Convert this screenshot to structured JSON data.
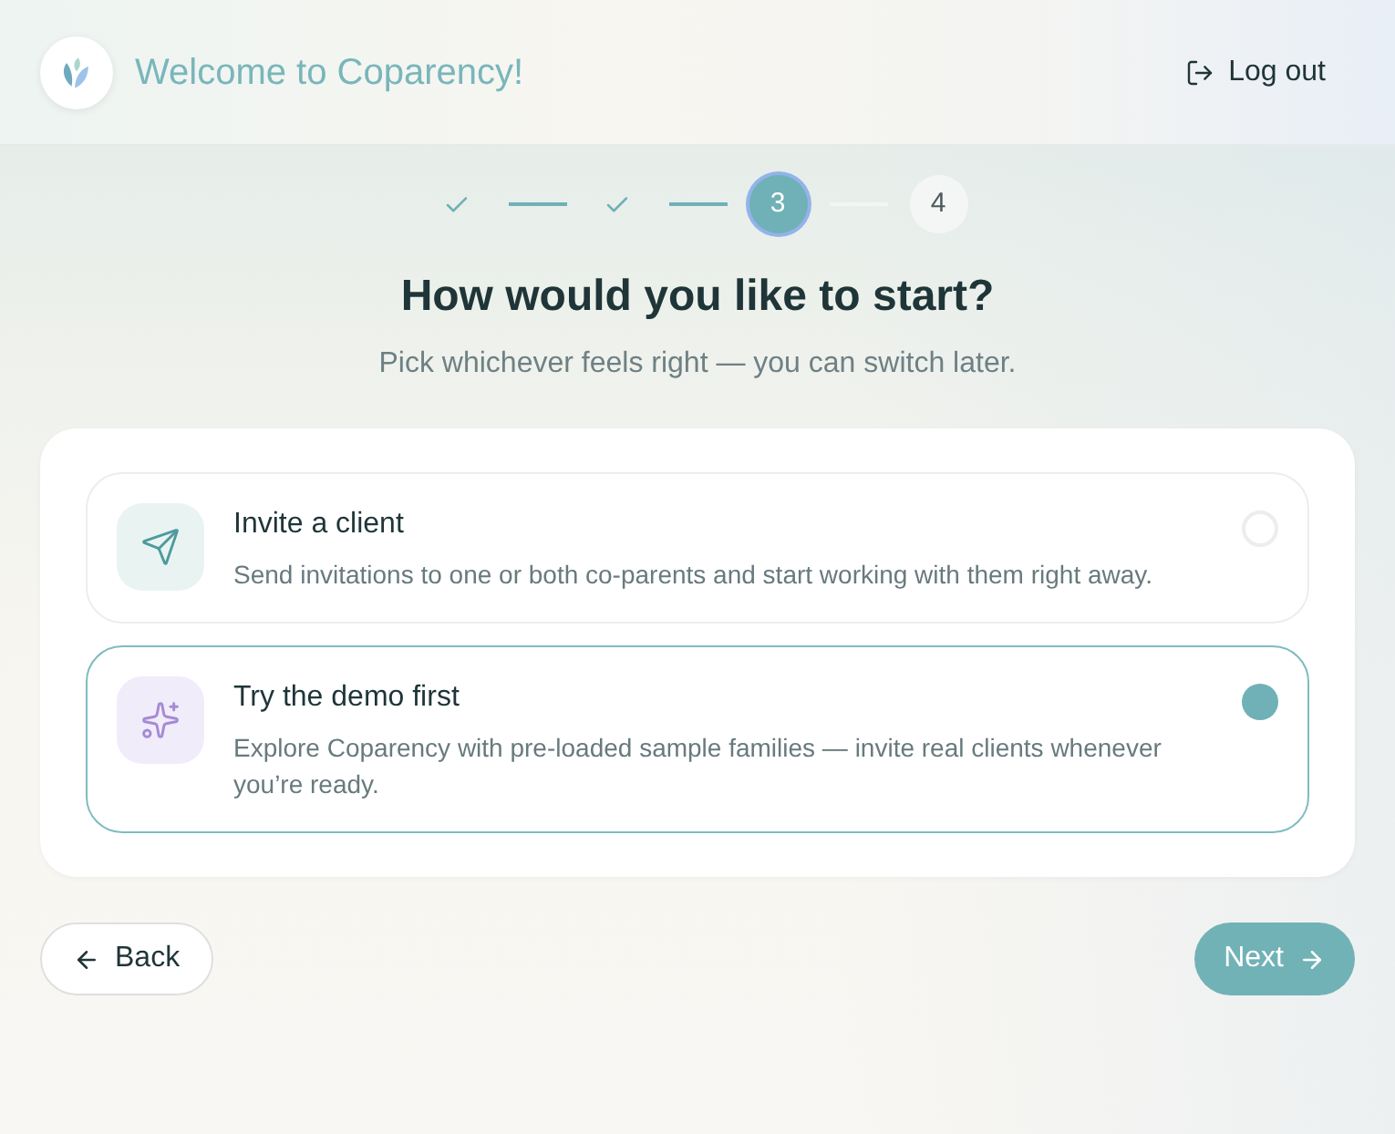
{
  "header": {
    "title": "Welcome to Coparency!",
    "logout": "Log out"
  },
  "stepper": [
    {
      "kind": "done"
    },
    {
      "kind": "done"
    },
    {
      "label": "3",
      "kind": "current"
    },
    {
      "label": "4",
      "kind": "upcoming"
    }
  ],
  "heading": "How would you like to start?",
  "subheading": "Pick whichever feels right — you can switch later.",
  "options": [
    {
      "kind": "send",
      "title": "Invite a client",
      "description": "Send invitations to one or both co-parents and start working with them right away.",
      "selected": false
    },
    {
      "kind": "sparkle",
      "title": "Try the demo first",
      "description": "Explore Coparency with pre-loaded sample families — invite real clients whenever you’re ready.",
      "selected": true
    }
  ],
  "buttons": {
    "back": "Back",
    "next": "Next"
  }
}
